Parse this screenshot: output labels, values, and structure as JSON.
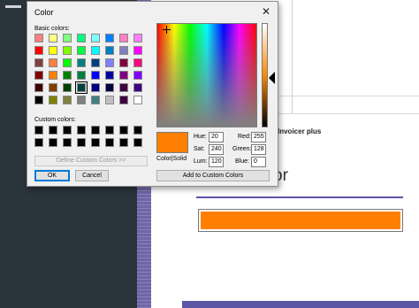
{
  "colors": {
    "selected": "#ff8000",
    "app_accent": "#5b55a5",
    "sidebar_bg": "#2a343b"
  },
  "dialog": {
    "title": "Color",
    "close_glyph": "✕",
    "basic_colors_label": "Basic colors:",
    "custom_colors_label": "Custom colors:",
    "define_custom_label": "Define Custom Colors >>",
    "ok_label": "OK",
    "cancel_label": "Cancel",
    "add_custom_label": "Add to Custom Colors",
    "color_solid_label": "Color|Solid",
    "hue_label": "Hue:",
    "hue_value": "20",
    "sat_label": "Sat:",
    "sat_value": "240",
    "lum_label": "Lum:",
    "lum_value": "120",
    "red_label": "Red:",
    "red_value": "255",
    "green_label": "Green:",
    "green_value": "128",
    "blue_label": "Blue:",
    "blue_value": "0",
    "selected_basic_index": 35,
    "basic_colors": [
      "#ff8080",
      "#ffff80",
      "#80ff80",
      "#00ff80",
      "#80ffff",
      "#0080ff",
      "#ff80c0",
      "#ff80ff",
      "#ff0000",
      "#ffff00",
      "#80ff00",
      "#00ff40",
      "#00ffff",
      "#0080c0",
      "#8080c0",
      "#ff00ff",
      "#804040",
      "#ff8040",
      "#00ff00",
      "#008080",
      "#004080",
      "#8080ff",
      "#800040",
      "#ff0080",
      "#800000",
      "#ff8000",
      "#008000",
      "#008040",
      "#0000ff",
      "#0000a0",
      "#800080",
      "#8000ff",
      "#400000",
      "#804000",
      "#004000",
      "#004040",
      "#000080",
      "#000040",
      "#400040",
      "#400080",
      "#000000",
      "#808000",
      "#808040",
      "#808080",
      "#408080",
      "#c0c0c0",
      "#400040",
      "#ffffff"
    ],
    "custom_colors": [
      "#000000",
      "#000000",
      "#000000",
      "#000000",
      "#000000",
      "#000000",
      "#000000",
      "#000000",
      "#000000",
      "#000000",
      "#000000",
      "#000000",
      "#000000",
      "#000000",
      "#000000",
      "#000000"
    ]
  },
  "app": {
    "heading": "Invoicer plus",
    "big_text": "or",
    "swatch_color": "#ff8000"
  }
}
